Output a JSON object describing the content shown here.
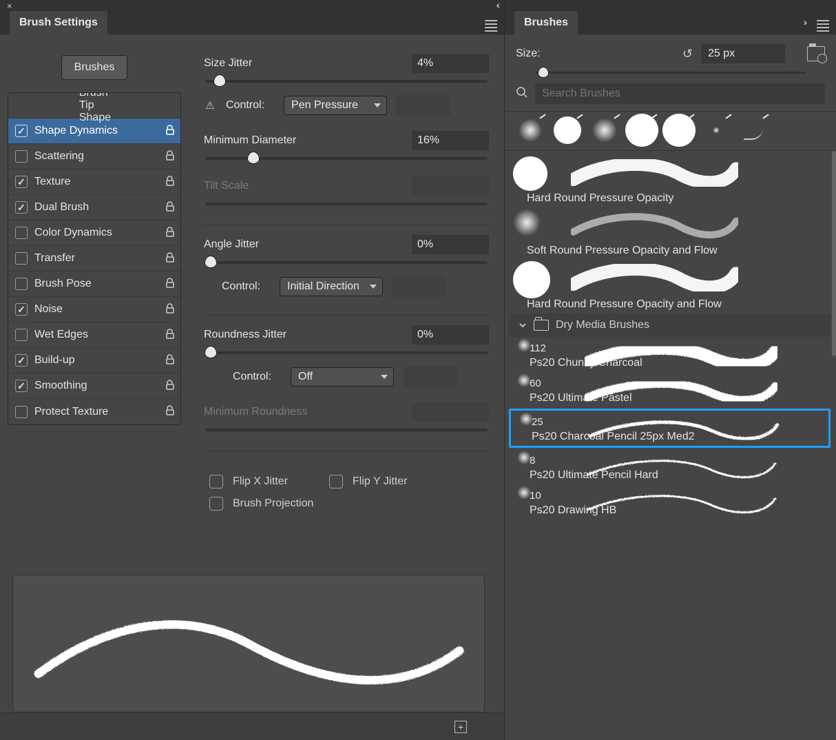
{
  "left": {
    "tab_title": "Brush Settings",
    "brushes_btn": "Brushes",
    "options_header": "Brush Tip Shape",
    "options": [
      {
        "label": "Shape Dynamics",
        "checked": true,
        "locked": true,
        "selected": true
      },
      {
        "label": "Scattering",
        "checked": false,
        "locked": true
      },
      {
        "label": "Texture",
        "checked": true,
        "locked": true
      },
      {
        "label": "Dual Brush",
        "checked": true,
        "locked": true
      },
      {
        "label": "Color Dynamics",
        "checked": false,
        "locked": true
      },
      {
        "label": "Transfer",
        "checked": false,
        "locked": true
      },
      {
        "label": "Brush Pose",
        "checked": false,
        "locked": true
      },
      {
        "label": "Noise",
        "checked": true,
        "locked": true
      },
      {
        "label": "Wet Edges",
        "checked": false,
        "locked": true
      },
      {
        "label": "Build-up",
        "checked": true,
        "locked": true
      },
      {
        "label": "Smoothing",
        "checked": true,
        "locked": true
      },
      {
        "label": "Protect Texture",
        "checked": false,
        "locked": true
      }
    ],
    "sliders": {
      "size_jitter": {
        "label": "Size Jitter",
        "value": "4%",
        "pos": 5
      },
      "size_control_lbl": "Control:",
      "size_control_val": "Pen Pressure",
      "min_diameter": {
        "label": "Minimum Diameter",
        "value": "16%",
        "pos": 17
      },
      "tilt_scale": {
        "label": "Tilt Scale",
        "value": "",
        "disabled": true,
        "pos": 0
      },
      "angle_jitter": {
        "label": "Angle Jitter",
        "value": "0%",
        "pos": 2
      },
      "angle_control_lbl": "Control:",
      "angle_control_val": "Initial Direction",
      "round_jitter": {
        "label": "Roundness Jitter",
        "value": "0%",
        "pos": 2
      },
      "round_control_lbl": "Control:",
      "round_control_val": "Off",
      "min_round": {
        "label": "Minimum Roundness",
        "value": "",
        "disabled": true,
        "pos": 0
      }
    },
    "flip_x": "Flip X Jitter",
    "flip_y": "Flip Y Jitter",
    "brush_proj": "Brush Projection"
  },
  "right": {
    "tab_title": "Brushes",
    "size_label": "Size:",
    "size_value": "25 px",
    "search_placeholder": "Search Brushes",
    "folder_name": "Dry Media Brushes",
    "top_brushes": [
      {
        "size": "",
        "name": "Hard Round Pressure Opacity",
        "style": "hard",
        "r": 25
      },
      {
        "size": "",
        "name": "Soft Round Pressure Opacity and Flow",
        "style": "soft",
        "r": 20
      },
      {
        "size": "",
        "name": "Hard Round Pressure Opacity and Flow",
        "style": "hard",
        "r": 27
      }
    ],
    "folder_brushes": [
      {
        "size": "112",
        "name": "Ps20  Chunky Charcoal"
      },
      {
        "size": "60",
        "name": "Ps20 Ultimate Pastel"
      },
      {
        "size": "25",
        "name": "Ps20 Charcoal Pencil 25px Med2",
        "selected": true
      },
      {
        "size": "8",
        "name": "Ps20 Ultimate Pencil Hard"
      },
      {
        "size": "10",
        "name": "Ps20 Drawing HB"
      }
    ]
  }
}
